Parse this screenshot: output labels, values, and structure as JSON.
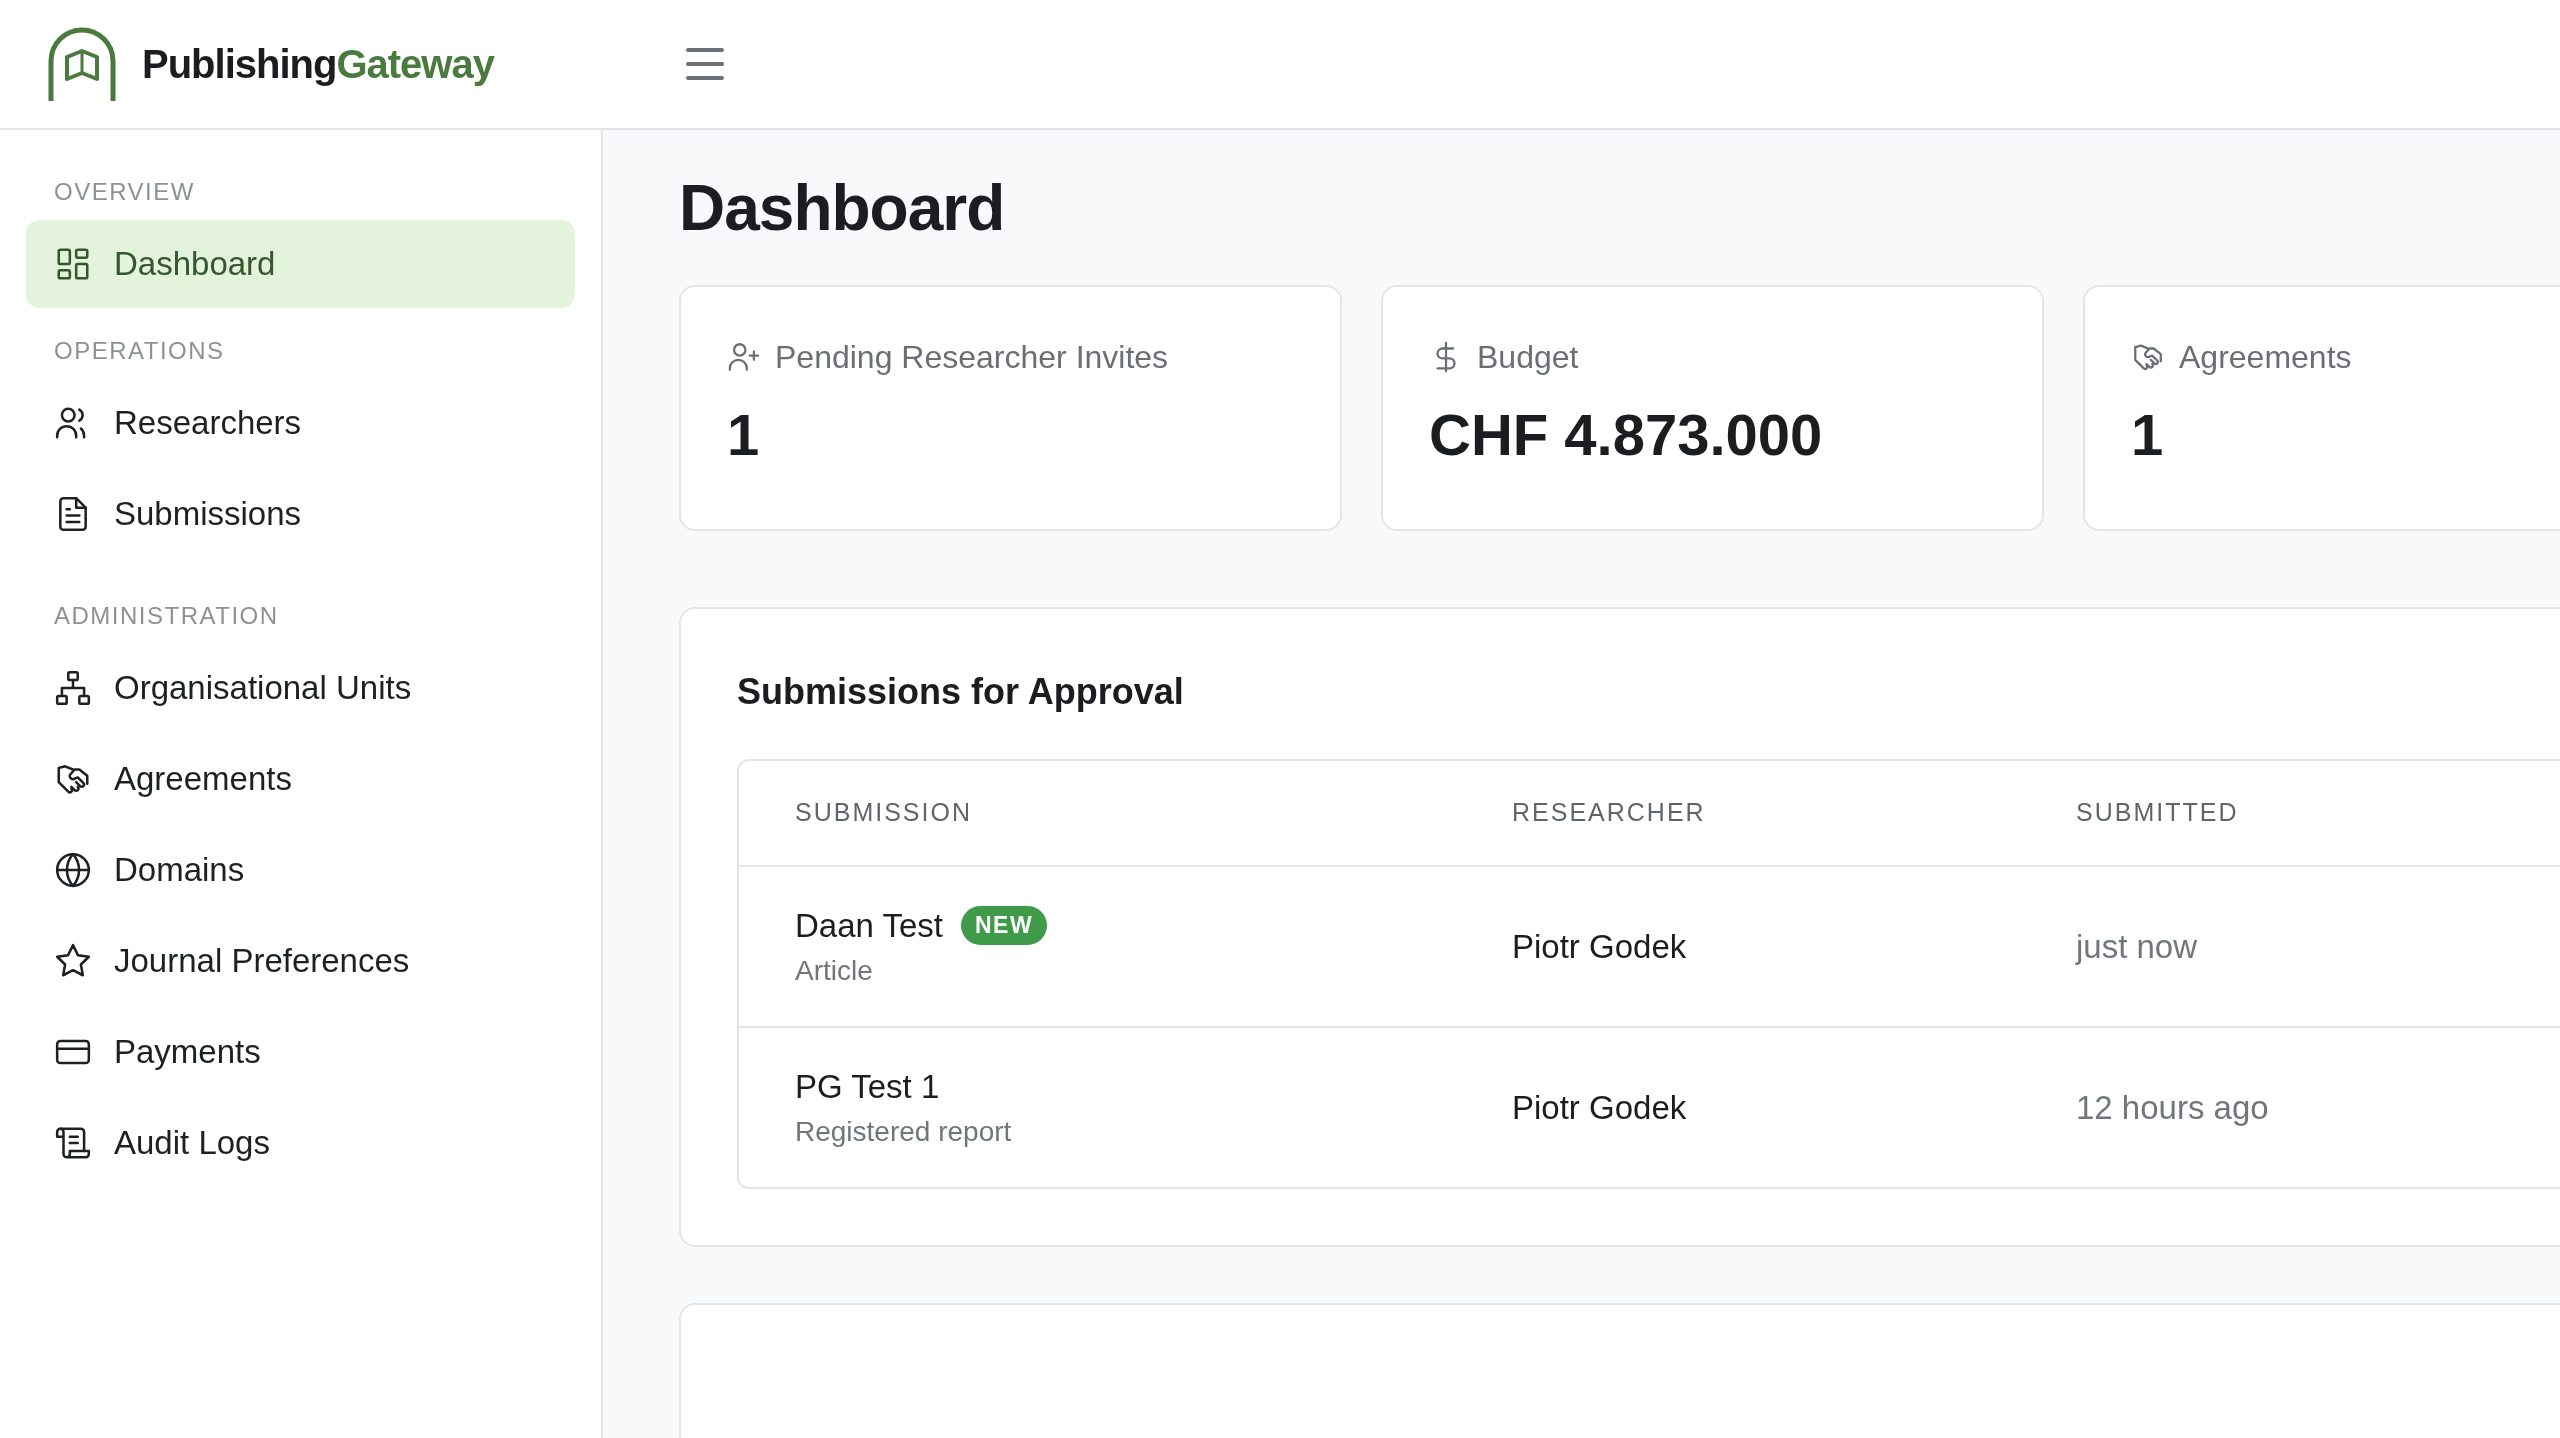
{
  "header": {
    "brand_primary": "Publishing",
    "brand_accent": "Gateway"
  },
  "sidebar": {
    "sections": [
      {
        "title": "OVERVIEW",
        "items": [
          {
            "label": "Dashboard",
            "selected": true
          }
        ]
      },
      {
        "title": "OPERATIONS",
        "items": [
          {
            "label": "Researchers",
            "selected": false
          },
          {
            "label": "Submissions",
            "selected": false
          }
        ]
      },
      {
        "title": "ADMINISTRATION",
        "items": [
          {
            "label": "Organisational Units",
            "selected": false
          },
          {
            "label": "Agreements",
            "selected": false
          },
          {
            "label": "Domains",
            "selected": false
          },
          {
            "label": "Journal Preferences",
            "selected": false
          },
          {
            "label": "Payments",
            "selected": false
          },
          {
            "label": "Audit Logs",
            "selected": false
          }
        ]
      }
    ]
  },
  "page_title": "Dashboard",
  "stats": [
    {
      "label": "Pending Researcher Invites",
      "value": "1"
    },
    {
      "label": "Budget",
      "value": "CHF 4.873.000"
    },
    {
      "label": "Agreements",
      "value": "1"
    }
  ],
  "approvals": {
    "title": "Submissions for Approval",
    "columns": [
      "SUBMISSION",
      "RESEARCHER",
      "SUBMITTED"
    ],
    "rows": [
      {
        "title": "Daan Test",
        "badge": "NEW",
        "type": "Article",
        "researcher": "Piotr Godek",
        "submitted": "just now"
      },
      {
        "title": "PG Test 1",
        "type": "Registered report",
        "researcher": "Piotr Godek",
        "submitted": "12 hours ago"
      }
    ]
  }
}
